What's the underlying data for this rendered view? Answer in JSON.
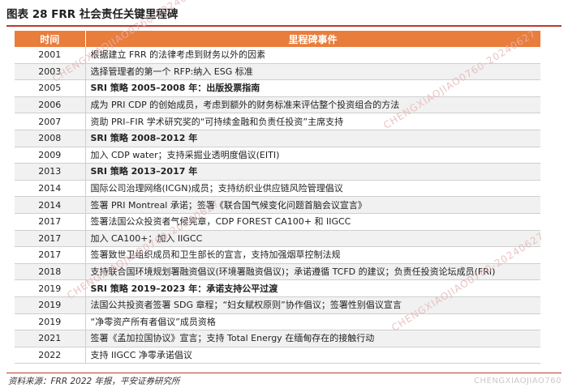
{
  "figure_title": "图表 28   FRR 社会责任关键里程碑",
  "table": {
    "headers": [
      "时间",
      "里程碑事件"
    ],
    "rows": [
      {
        "year": "2001",
        "event": "根据建立 FRR 的法律考虑到财务以外的因素",
        "phase": false
      },
      {
        "year": "2003",
        "event": "选择管理者的第一个 RFP:纳入 ESG 标准",
        "phase": false
      },
      {
        "year": "2005",
        "event": "SRI 策略 2005–2008 年：出版投票指南",
        "phase": true
      },
      {
        "year": "2006",
        "event": "成为 PRI CDP 的创始成员，考虑到额外的财务标准来评估整个投资组合的方法",
        "phase": false
      },
      {
        "year": "2007",
        "event": "资助 PRI–FIR 学术研究奖的“可持续金融和负责任投资”主席支持",
        "phase": false
      },
      {
        "year": "2008",
        "event": "SRI 策略 2008–2012 年",
        "phase": true
      },
      {
        "year": "2009",
        "event": "加入 CDP water；支持采掘业透明度倡议(EITI)",
        "phase": false
      },
      {
        "year": "2013",
        "event": "SRI 策略 2013–2017 年",
        "phase": true
      },
      {
        "year": "2014",
        "event": "国际公司治理网络(ICGN)成员；支持纺织业供应链风险管理倡议",
        "phase": false
      },
      {
        "year": "2014",
        "event": "签署 PRI Montreal 承诺；签署《联合国气候变化问题首脑会议宣言》",
        "phase": false
      },
      {
        "year": "2017",
        "event": "签署法国公众投资者气候宪章，CDP FOREST CA100+ 和 IIGCC",
        "phase": false
      },
      {
        "year": "2017",
        "event": "加入 CA100+；加入 IIGCC",
        "phase": false
      },
      {
        "year": "2017",
        "event": "签署致世卫组织成员和卫生部长的宣言，支持加强烟草控制法规",
        "phase": false
      },
      {
        "year": "2018",
        "event": "支持联合国环境规划署融资倡议(环境署融资倡议)；承诺遵循 TCFD 的建议；负责任投资论坛成员(FRI)",
        "phase": false
      },
      {
        "year": "2019",
        "event": "SRI 策略 2019–2023 年：承诺支持公平过渡",
        "phase": true
      },
      {
        "year": "2019",
        "event": "法国公共投资者签署 SDG 章程；“妇女赋权原则”协作倡议；签署性别倡议宣言",
        "phase": false
      },
      {
        "year": "2019",
        "event": "“净零资产所有者倡议”成员资格",
        "phase": false
      },
      {
        "year": "2021",
        "event": "签署《孟加拉国协议》宣言；支持 Total Energy 在缅甸存在的接触行动",
        "phase": false
      },
      {
        "year": "2022",
        "event": "支持 IIGCC 净零承诺倡议",
        "phase": false
      }
    ]
  },
  "source": "资料来源：FRR 2022 年报，平安证券研究所",
  "watermark": "CHENGXIAOJIAO0760-20240627",
  "watermark_corner": "CHENGXIAOJIAO760",
  "colors": {
    "header_bg": "#e97d3b",
    "title_rule": "#c0392b",
    "row_alt": "#f1f1f1"
  }
}
